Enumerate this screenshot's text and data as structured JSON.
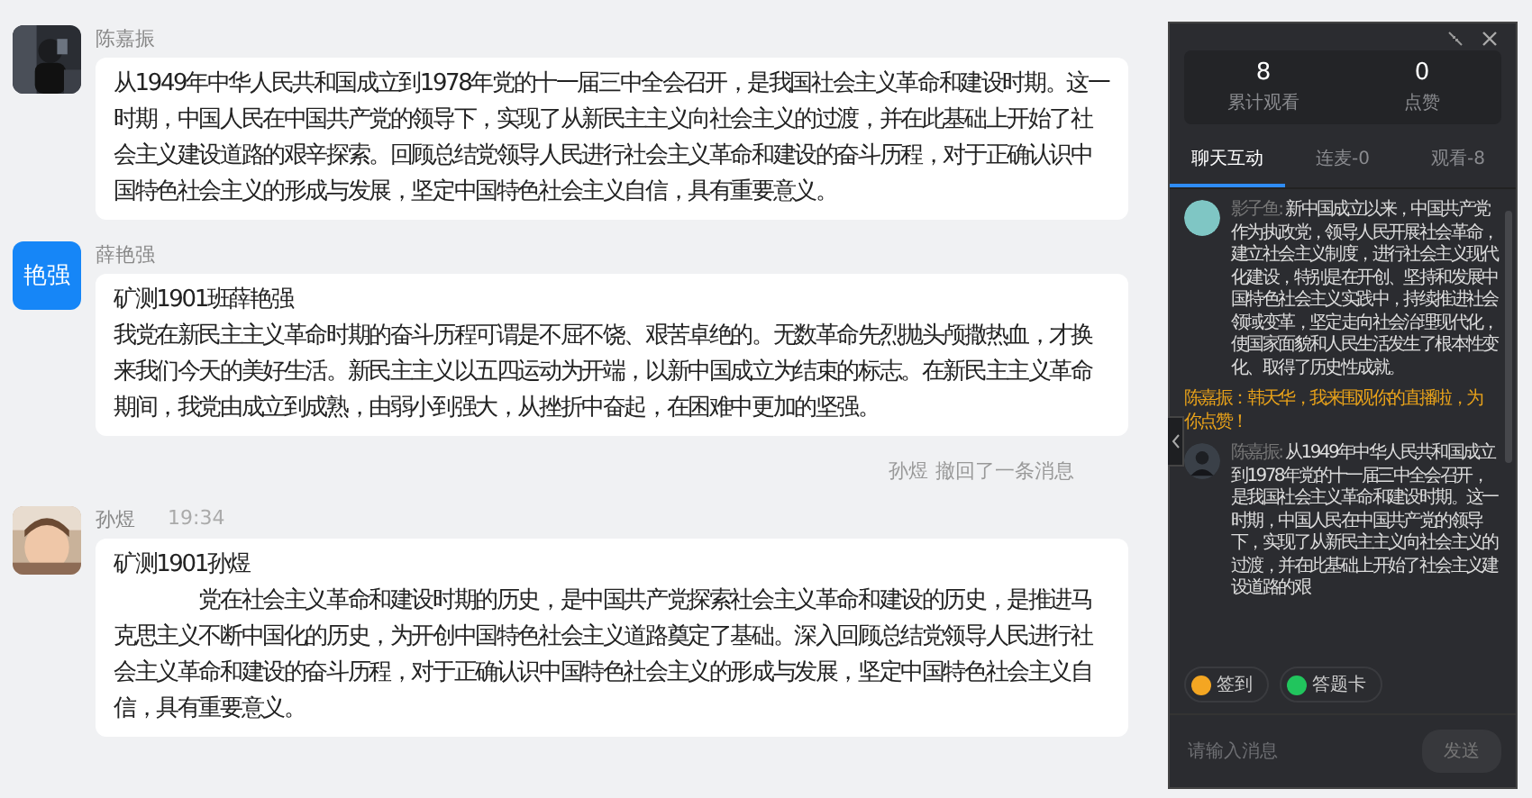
{
  "messages": [
    {
      "name": "陈嘉振",
      "lines": [
        "从1949年中华人民共和国成立到1978年党的十一届三中全会召开，是我国社会主义革命和建设时期。这一时期，中国人民在中国共产党的领导下，实现了从新民主主义向社会主义的过渡，并在此基础上开始了社会主义建设道路的艰辛探索。回顾总结党领导人民进行社会主义革命和建设的奋斗历程，对于正确认识中国特色社会主义的形成与发展，坚定中国特色社会主义自信，具有重要意义。"
      ]
    },
    {
      "kind": "text",
      "name": "薛艳强",
      "avatar_text": "艳强",
      "lines": [
        "矿测1901班薛艳强",
        "我党在新民主主义革命时期的奋斗历程可谓是不屈不饶、艰苦卓绝的。无数革命先烈抛头颅撒热血，才换来我们今天的美好生活。新民主主义以五四运动为开端，以新中国成立为结束的标志。在新民主主义革命期间，我党由成立到成熟，由弱小到强大，从挫折中奋起，在困难中更加的坚强。"
      ]
    },
    {
      "kind": "notice",
      "name": "孙煜",
      "text": "撤回了一条消息"
    },
    {
      "name": "孙煜",
      "time": "19:34",
      "lines": [
        "矿测1901孙煜",
        "　　　　党在社会主义革命和建设时期的历史，是中国共产党探索社会主义革命和建设的历史，是推进马克思主义不断中国化的历史，为开创中国特色社会主义道路奠定了基础。深入回顾总结党领导人民进行社会主义革命和建设的奋斗历程，对于正确认识中国特色社会主义的形成与发展，坚定中国特色社会主义自信，具有重要意义。"
      ]
    }
  ],
  "panel": {
    "stats": [
      {
        "value": "8",
        "label": "累计观看"
      },
      {
        "value": "0",
        "label": "点赞"
      }
    ],
    "tabs": [
      {
        "label": "聊天互动",
        "selected": true
      },
      {
        "label": "连麦-0",
        "selected": false
      },
      {
        "label": "观看-8",
        "selected": false
      }
    ],
    "chat": [
      {
        "kind": "cartoon",
        "name": "影子鱼:",
        "text": "新中国成立以来，中国共产党作为执政党，领导人民开展社会革命，建立社会主义制度，进行社会主义现代化建设，特别是在开创、坚持和发展中国特色社会主义实践中，持续推进社会领域变革，坚定走向社会治理现代化，使国家面貌和人民生活发生了根本性变化、取得了历史性成就。"
      },
      {
        "kind": "system",
        "text": "陈嘉振：韩天华，我来围观你的直播啦，为你点赞！"
      },
      {
        "name": "陈嘉振:",
        "text": "从1949年中华人民共和国成立到1978年党的十一届三中全会召开，是我国社会主义革命和建设时期。这一时期，中国人民在中国共产党的领导下，实现了从新民主主义向社会主义的过渡，并在此基础上开始了社会主义建设道路的艰"
      }
    ],
    "chips": [
      {
        "kind": "checkin",
        "label": "签到"
      },
      {
        "kind": "quiz",
        "label": "答题卡"
      }
    ],
    "input": {
      "placeholder": "请输入消息"
    },
    "send": "发送"
  }
}
